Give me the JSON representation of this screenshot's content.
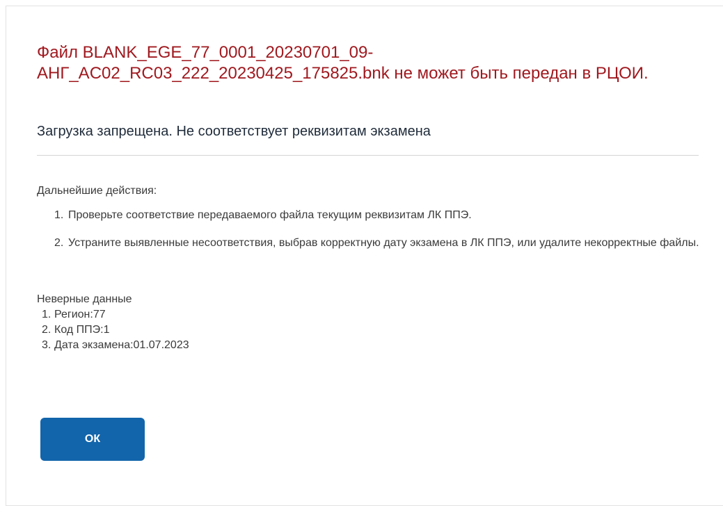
{
  "dialog": {
    "title": "Файл BLANK_EGE_77_0001_20230701_09-АНГ_AC02_RC03_222_20230425_175825.bnk не может быть передан в РЦОИ.",
    "subtitle": "Загрузка запрещена. Не соответствует реквизитам экзамена",
    "next_steps": {
      "label": "Дальнейшие действия:",
      "items": [
        {
          "num": "1.",
          "text": "Проверьте соответствие передаваемого файла текущим реквизитам ЛК ППЭ."
        },
        {
          "num": "2.",
          "text": "Устраните выявленные несоответствия, выбрав корректную дату экзамена в ЛК ППЭ, или удалите некорректные файлы."
        }
      ]
    },
    "wrong_data": {
      "label": "Неверные данные",
      "items": [
        {
          "num": "1.",
          "text": "Регион:77"
        },
        {
          "num": "2.",
          "text": "Код ППЭ:1"
        },
        {
          "num": "3.",
          "text": "Дата экзамена:01.07.2023"
        }
      ]
    },
    "ok_label": "ОК"
  },
  "colors": {
    "title": "#a0191f",
    "button": "#1265ab",
    "divider": "#d5d5d5"
  }
}
